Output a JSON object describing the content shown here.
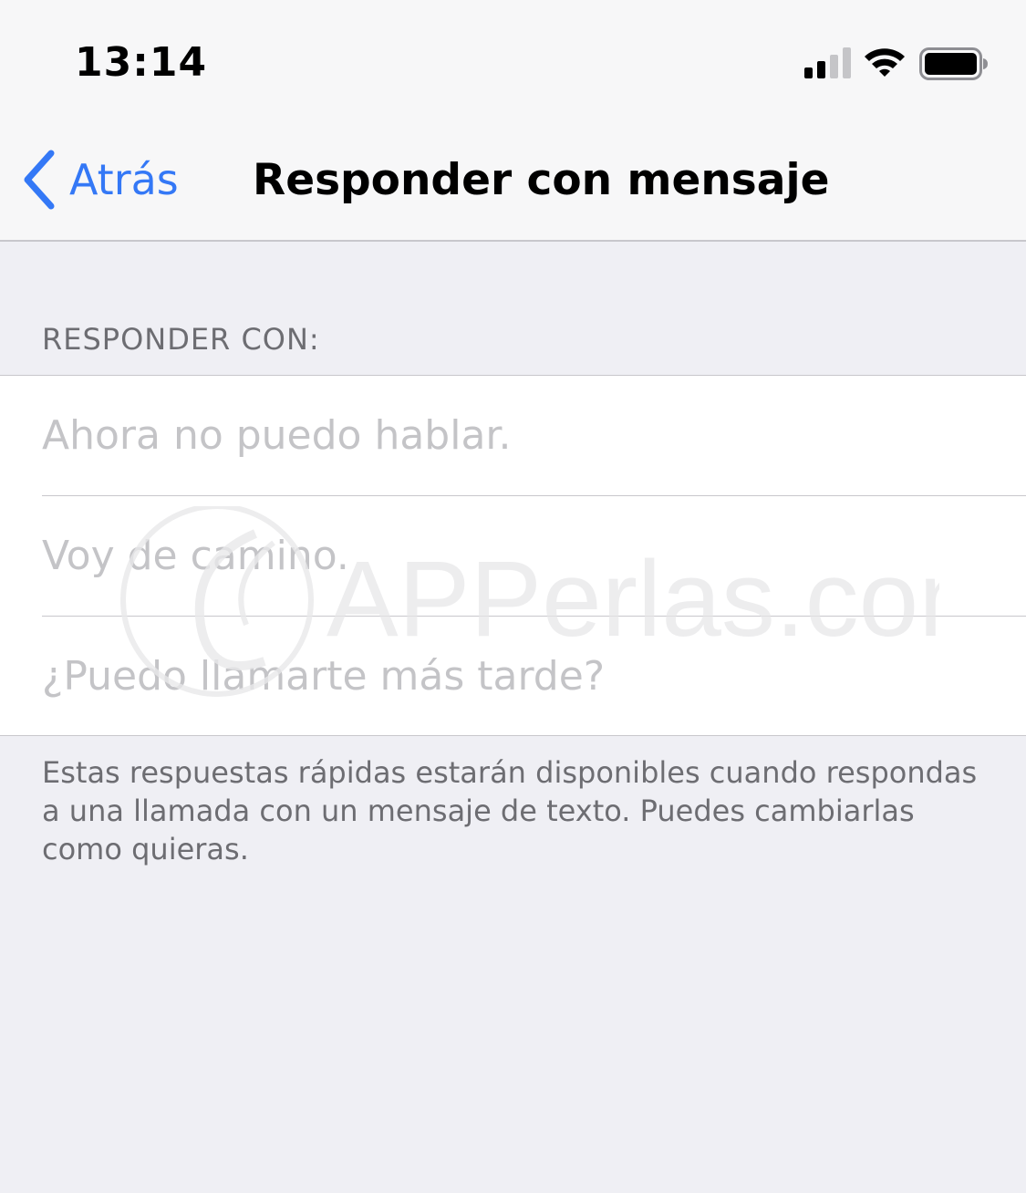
{
  "status_bar": {
    "time": "13:14",
    "icons": [
      "signal-icon",
      "wifi-icon",
      "battery-icon"
    ]
  },
  "nav": {
    "back_label": "Atrás",
    "back_icon": "chevron-left-icon",
    "title": "Responder con mensaje"
  },
  "section": {
    "header": "RESPONDER CON:",
    "items": [
      {
        "placeholder": "Ahora no puedo hablar."
      },
      {
        "placeholder": "Voy de camino."
      },
      {
        "placeholder": "¿Puedo llamarte más tarde?"
      }
    ],
    "footer": "Estas respuestas rápidas estarán disponibles cuando respondas a una llamada con un mensaje de texto. Puedes cambiarlas como quieras."
  },
  "watermark": {
    "text": "APPerlas.com"
  },
  "colors": {
    "accent": "#3478f6",
    "background": "#efeff4",
    "bar_background": "#f7f7f8",
    "placeholder": "#c4c4c7",
    "secondary_text": "#6d6d72",
    "separator": "#c8c7cc"
  }
}
